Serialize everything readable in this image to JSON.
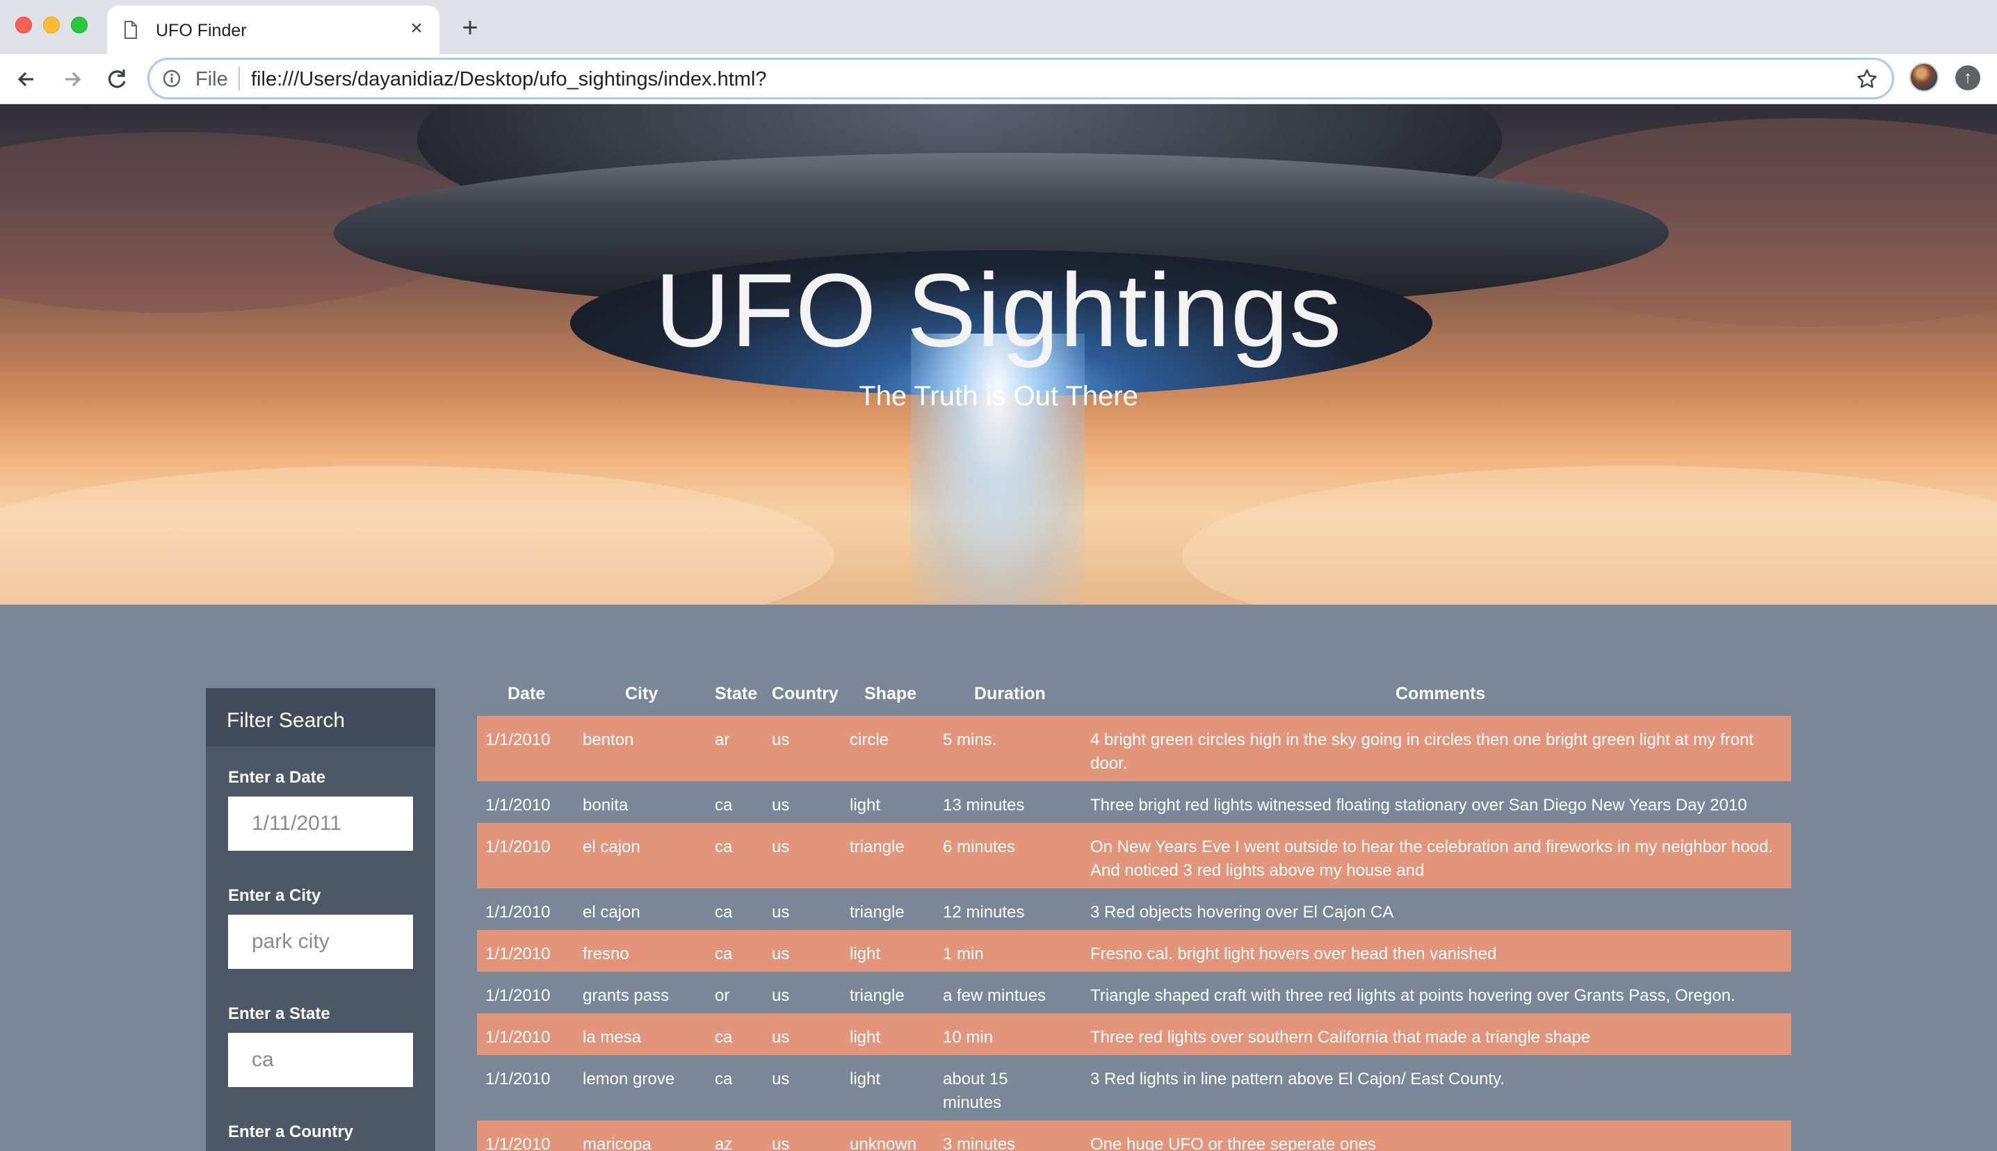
{
  "browser": {
    "tab_title": "UFO Finder",
    "new_tab": "+",
    "tab_close": "×",
    "scheme": "File",
    "url": "file:///Users/dayanidiaz/Desktop/ufo_sightings/index.html?"
  },
  "hero": {
    "title": "UFO Sightings",
    "subtitle": "The Truth is Out There"
  },
  "filter": {
    "heading": "Filter Search",
    "fields": [
      {
        "label": "Enter a Date",
        "placeholder": "1/11/2011"
      },
      {
        "label": "Enter a City",
        "placeholder": "park city"
      },
      {
        "label": "Enter a State",
        "placeholder": "ca"
      },
      {
        "label": "Enter a Country",
        "placeholder": ""
      }
    ]
  },
  "table": {
    "headers": [
      "Date",
      "City",
      "State",
      "Country",
      "Shape",
      "Duration",
      "Comments"
    ],
    "rows": [
      {
        "date": "1/1/2010",
        "city": "benton",
        "state": "ar",
        "country": "us",
        "shape": "circle",
        "duration": "5 mins.",
        "comments": "4 bright green circles high in the sky going in circles then one bright green light at my front door."
      },
      {
        "date": "1/1/2010",
        "city": "bonita",
        "state": "ca",
        "country": "us",
        "shape": "light",
        "duration": "13 minutes",
        "comments": "Three bright red lights witnessed floating stationary over San Diego New Years Day 2010"
      },
      {
        "date": "1/1/2010",
        "city": "el cajon",
        "state": "ca",
        "country": "us",
        "shape": "triangle",
        "duration": "6 minutes",
        "comments": "On New Years Eve I went outside to hear the celebration and fireworks in my neighbor hood. And noticed 3 red lights above my house and"
      },
      {
        "date": "1/1/2010",
        "city": "el cajon",
        "state": "ca",
        "country": "us",
        "shape": "triangle",
        "duration": "12 minutes",
        "comments": "3 Red objects hovering over El Cajon CA"
      },
      {
        "date": "1/1/2010",
        "city": "fresno",
        "state": "ca",
        "country": "us",
        "shape": "light",
        "duration": "1 min",
        "comments": "Fresno cal. bright light hovers over head then vanished"
      },
      {
        "date": "1/1/2010",
        "city": "grants pass",
        "state": "or",
        "country": "us",
        "shape": "triangle",
        "duration": "a few mintues",
        "comments": "Triangle shaped craft with three red lights at points hovering over Grants Pass, Oregon."
      },
      {
        "date": "1/1/2010",
        "city": "la mesa",
        "state": "ca",
        "country": "us",
        "shape": "light",
        "duration": "10 min",
        "comments": "Three red lights over southern California that made a triangle shape"
      },
      {
        "date": "1/1/2010",
        "city": "lemon grove",
        "state": "ca",
        "country": "us",
        "shape": "light",
        "duration": "about 15 minutes",
        "comments": "3 Red lights in line pattern above El Cajon/ East County."
      },
      {
        "date": "1/1/2010",
        "city": "maricopa",
        "state": "az",
        "country": "us",
        "shape": "unknown",
        "duration": "3 minutes",
        "comments": "One huge UFO or three seperate ones"
      }
    ]
  }
}
